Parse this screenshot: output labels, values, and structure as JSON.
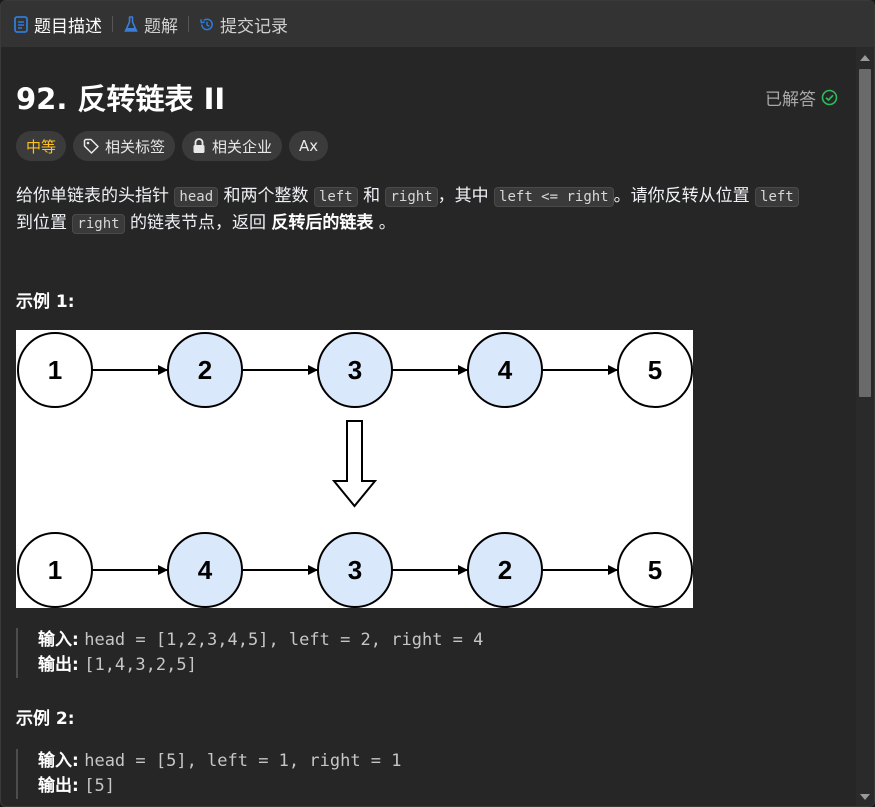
{
  "tabs": [
    {
      "label": "题目描述",
      "icon": "description-icon",
      "active": true
    },
    {
      "label": "题解",
      "icon": "flask-icon",
      "active": false
    },
    {
      "label": "提交记录",
      "icon": "history-icon",
      "active": false
    }
  ],
  "problem": {
    "title": "92. 反转链表 II",
    "status": "已解答",
    "difficulty": "中等",
    "tags": [
      {
        "label": "相关标签",
        "icon": "tag-icon"
      },
      {
        "label": "相关企业",
        "icon": "lock-icon"
      },
      {
        "label": "Ax",
        "icon": "translate-icon"
      }
    ],
    "desc": {
      "p1": "给你单链表的头指针",
      "c1": "head",
      "p2": "和两个整数",
      "c2": "left",
      "p3": "和",
      "c3": "right",
      "p4": "，其中",
      "c4": "left <= right",
      "p5": "。请你反转从位置",
      "c5": "left",
      "p6": "到位置",
      "c6": "right",
      "p7": "的链表节点，返回",
      "b1": "反转后的链表",
      "p8": "。"
    }
  },
  "diagram": {
    "row1": [
      "1",
      "2",
      "3",
      "4",
      "5"
    ],
    "row2": [
      "1",
      "4",
      "3",
      "2",
      "5"
    ],
    "highlighted_fill": "#dae8fc",
    "plain_fill": "#ffffff"
  },
  "examples": [
    {
      "title": "示例 1:",
      "input_label": "输入:",
      "input": "head = [1,2,3,4,5], left = 2, right = 4",
      "output_label": "输出:",
      "output": "[1,4,3,2,5]"
    },
    {
      "title": "示例 2:",
      "input_label": "输入:",
      "input": "head = [5], left = 1, right = 1",
      "output_label": "输出:",
      "output": "[5]"
    }
  ],
  "colors": {
    "background": "#262626",
    "tabbar": "#333333",
    "difficulty": "#ffc01e",
    "solved_check": "#2cbb5d",
    "tab_icon_blue": "#2f7bd8"
  }
}
